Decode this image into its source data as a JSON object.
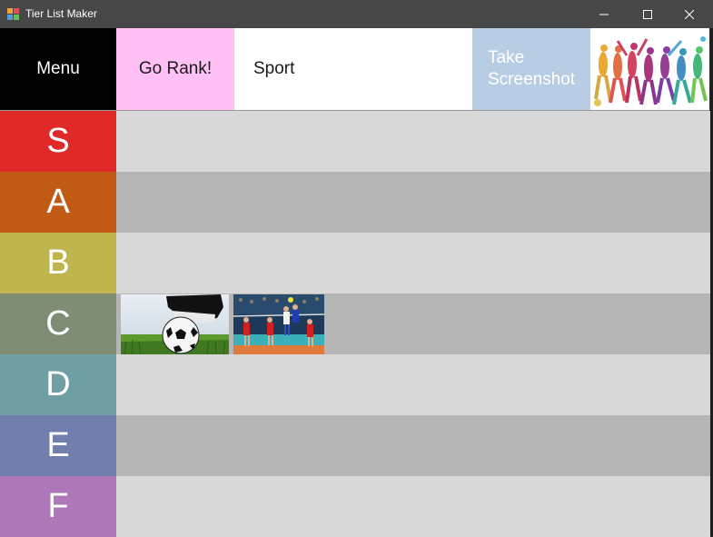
{
  "window": {
    "title": "Tier List Maker",
    "icons": [
      "app-grid-icon",
      "minimize-icon",
      "maximize-icon",
      "close-icon"
    ]
  },
  "toolbar": {
    "menu_label": "Menu",
    "rank_label": "Go Rank!",
    "topic": "Sport",
    "screenshot_label": "Take\nScreenshot",
    "logo_icon": "sports-silhouettes-logo"
  },
  "tiers": [
    {
      "label": "S",
      "color": "#e02a2a",
      "lane_color": "#d8d8d8",
      "items": []
    },
    {
      "label": "A",
      "color": "#c05a14",
      "lane_color": "#b5b5b5",
      "items": []
    },
    {
      "label": "B",
      "color": "#bfb54e",
      "lane_color": "#d8d8d8",
      "items": []
    },
    {
      "label": "C",
      "color": "#7f8d74",
      "lane_color": "#b5b5b5",
      "items": [
        "soccer-ball-image",
        "volleyball-match-image"
      ]
    },
    {
      "label": "D",
      "color": "#6f9fa3",
      "lane_color": "#d8d8d8",
      "items": []
    },
    {
      "label": "E",
      "color": "#727fae",
      "lane_color": "#b5b5b5",
      "items": []
    },
    {
      "label": "F",
      "color": "#ad77b8",
      "lane_color": "#d8d8d8",
      "items": []
    }
  ]
}
